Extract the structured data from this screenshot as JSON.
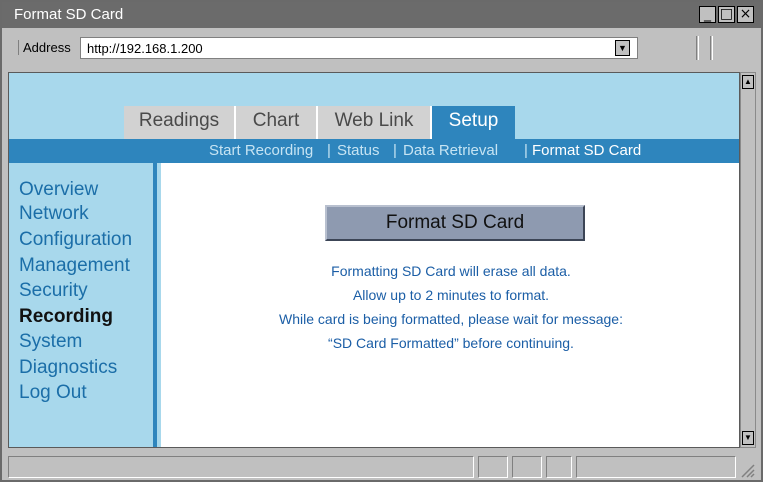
{
  "window": {
    "title": "Format SD Card",
    "buttons": {
      "minimize": "_",
      "maximize": "□",
      "close": "×"
    }
  },
  "address_bar": {
    "label": "Address",
    "url": "http://192.168.1.200"
  },
  "tabs": [
    {
      "label": "Readings",
      "active": false
    },
    {
      "label": "Chart",
      "active": false
    },
    {
      "label": "Web Link",
      "active": false
    },
    {
      "label": "Setup",
      "active": true
    }
  ],
  "subnav": {
    "items": [
      "Start Recording",
      "Status",
      "Data Retrieval",
      "Format SD Card"
    ],
    "separator": "|",
    "current": "Format SD Card"
  },
  "sidebar": {
    "items": [
      {
        "label": "Overview",
        "active": false
      },
      {
        "label": "Network",
        "active": false
      },
      {
        "label": "Configuration",
        "active": false
      },
      {
        "label": "Management",
        "active": false
      },
      {
        "label": "Security",
        "active": false
      },
      {
        "label": "Recording",
        "active": true
      },
      {
        "label": "System",
        "active": false
      },
      {
        "label": "Diagnostics",
        "active": false
      },
      {
        "label": "Log Out",
        "active": false
      }
    ]
  },
  "main": {
    "button_label": "Format SD Card",
    "messages": [
      "Formatting SD Card will erase all data.",
      "Allow up to 2 minutes to format.",
      "While card is being formatted, please wait for message:",
      "“SD Card Formatted” before continuing."
    ]
  },
  "colors": {
    "accent": "#2e85bd",
    "page_background": "#a8d8ec",
    "link_text": "#1b6ea8",
    "button": "#8e9ab0"
  }
}
